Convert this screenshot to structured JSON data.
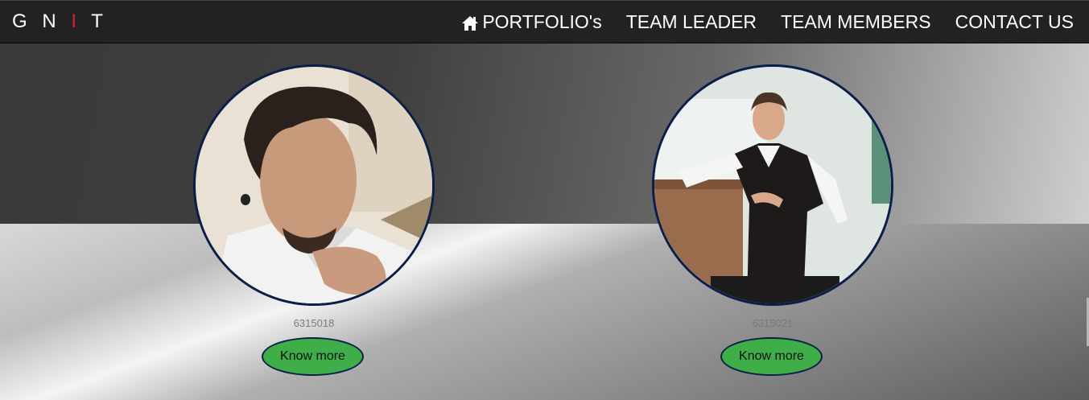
{
  "navbar": {
    "brand": {
      "part1": "G N ",
      "accent": "I",
      "part2": " T"
    },
    "links": [
      {
        "label": "PORTFOLIO's",
        "icon": "home-icon"
      },
      {
        "label": "TEAM LEADER"
      },
      {
        "label": "TEAM MEMBERS"
      },
      {
        "label": "CONTACT US"
      }
    ]
  },
  "members": [
    {
      "roll": "6315018",
      "button": "Know more"
    },
    {
      "roll": "6315021",
      "button": "Know more"
    }
  ],
  "colors": {
    "navbar_bg": "#222222",
    "brand_accent": "#d9252a",
    "button_bg": "#3fae49",
    "avatar_border": "#0b1e4a"
  }
}
